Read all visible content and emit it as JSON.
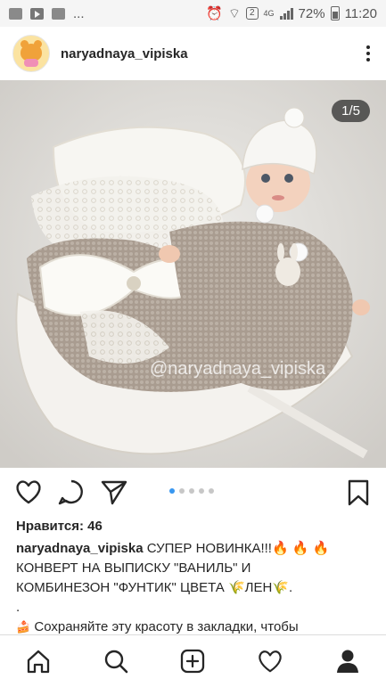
{
  "status_bar": {
    "overflow": "...",
    "sim_badge": "2",
    "network": "4G",
    "battery": "72%",
    "time": "11:20"
  },
  "post": {
    "username": "naryadnaya_vipiska",
    "image_counter": "1/5",
    "watermark": "@naryadnaya_vipiska",
    "carousel_total": 5,
    "carousel_index": 1
  },
  "engagement": {
    "likes_text": "Нравится: 46"
  },
  "caption": {
    "username": "naryadnaya_vipiska",
    "line1": "СУПЕР НОВИНКА!!!",
    "line2": "КОНВЕРТ НА ВЫПИСКУ \"ВАНИЛЬ\" И",
    "line3a": "КОМБИНЕЗОН \"ФУНТИК\" ЦВЕТА ",
    "line3b": "ЛЕН",
    "line4": ".",
    "line5": "Сохраняйте эту красоту в закладки, чтобы"
  },
  "icons": {
    "like": "heart-icon",
    "comment": "comment-icon",
    "share": "send-icon",
    "save": "bookmark-icon",
    "nav": [
      "home-icon",
      "search-icon",
      "add-post-icon",
      "activity-heart-icon",
      "profile-icon"
    ]
  },
  "colors": {
    "accent_blue": "#3897f0",
    "text": "#262626",
    "fire": "#ff6a00"
  }
}
